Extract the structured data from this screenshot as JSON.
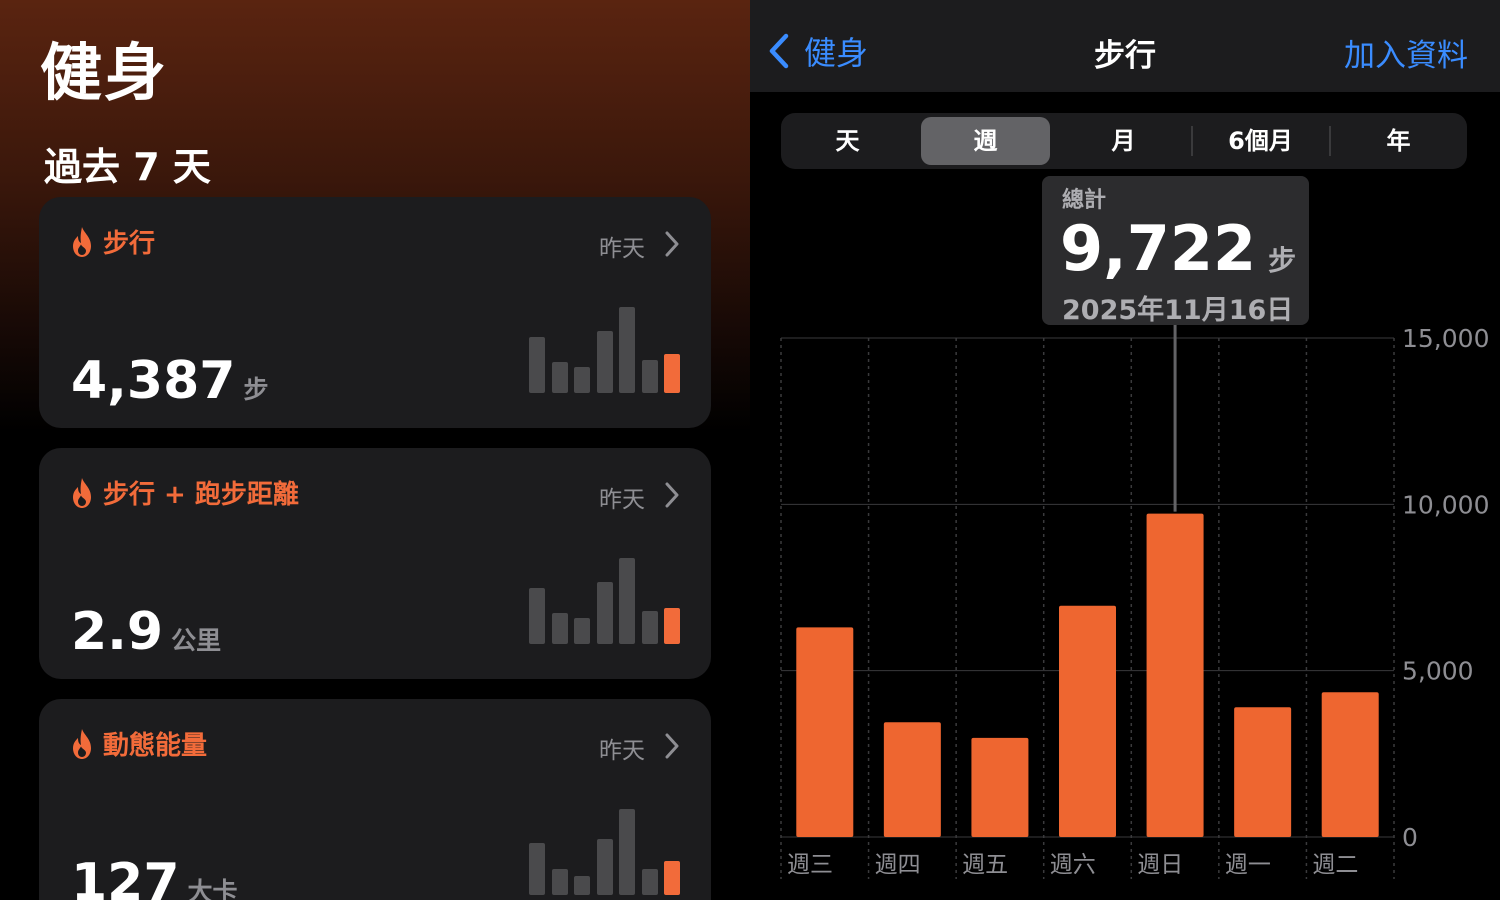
{
  "left": {
    "app_title": "健身",
    "section_title": "過去 7 天",
    "cards": [
      {
        "title": "步行",
        "when": "昨天",
        "value": "4,387",
        "unit": "步",
        "mini_values": [
          0.65,
          0.36,
          0.3,
          0.72,
          1.0,
          0.38,
          0.45
        ]
      },
      {
        "title": "步行 + 跑步距離",
        "when": "昨天",
        "value": "2.9",
        "unit": "公里",
        "mini_values": [
          0.65,
          0.36,
          0.3,
          0.72,
          1.0,
          0.38,
          0.42
        ]
      },
      {
        "title": "動態能量",
        "when": "昨天",
        "value": "127",
        "unit": "大卡",
        "mini_values": [
          0.6,
          0.3,
          0.22,
          0.65,
          1.0,
          0.3,
          0.4
        ]
      }
    ],
    "icons": {
      "flame": "flame-icon",
      "chevron": "chevron-right-icon"
    },
    "accent": "#f26b3a"
  },
  "right": {
    "back_label": "健身",
    "title": "步行",
    "add_label": "加入資料",
    "segments": [
      "天",
      "週",
      "月",
      "6個月",
      "年"
    ],
    "selected_segment": 1,
    "tooltip": {
      "label": "總計",
      "value": "9,722",
      "unit": "步",
      "date": "2025年11月16日"
    },
    "link_color": "#3a8cff"
  },
  "chart_data": {
    "type": "bar",
    "categories": [
      "週三",
      "週四",
      "週五",
      "週六",
      "週日",
      "週一",
      "週二"
    ],
    "values": [
      6300,
      3450,
      2980,
      6950,
      9722,
      3900,
      4350
    ],
    "yticks": [
      "15,000",
      "10,000",
      "5,000",
      "0"
    ],
    "ytick_values": [
      15000,
      10000,
      5000,
      0
    ],
    "ylim": [
      0,
      15000
    ],
    "highlight_index": 4,
    "bar_color": "#ee6630",
    "grid": true
  }
}
